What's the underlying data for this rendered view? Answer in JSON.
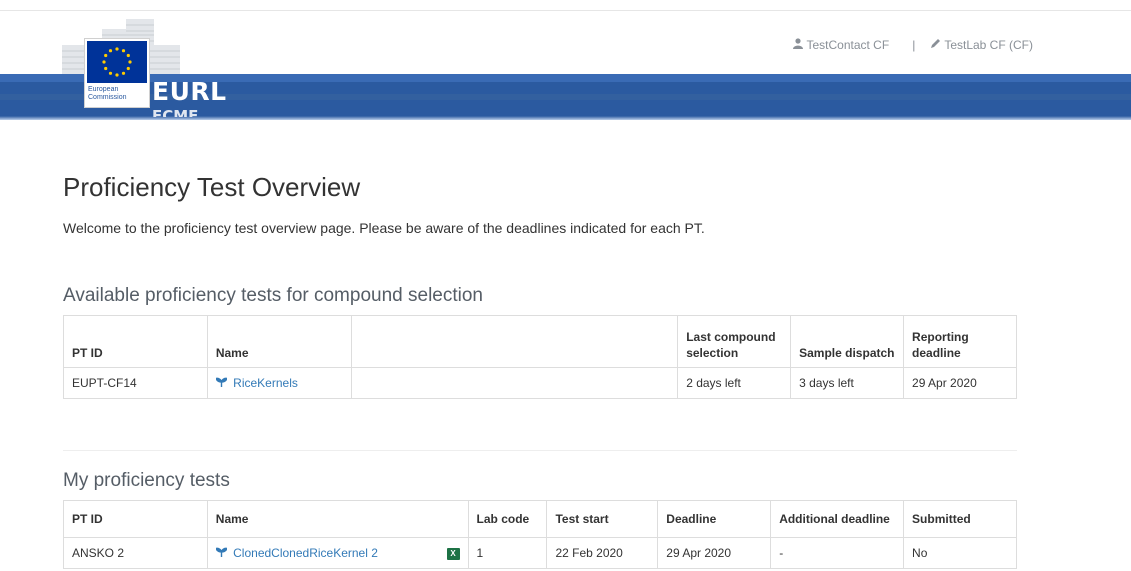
{
  "header": {
    "org_name_line1": "European",
    "org_name_line2": "Commission",
    "brand": "EURL",
    "brand_sub": "FCMF",
    "user_contact": "TestContact CF",
    "separator": "|",
    "user_lab": "TestLab CF (CF)",
    "colors": {
      "band": "#2b5aa0",
      "flag": "#003399",
      "stars": "#ffcc00"
    }
  },
  "page": {
    "title": "Proficiency Test Overview",
    "welcome": "Welcome to the proficiency test overview page. Please be aware of the deadlines indicated for each PT."
  },
  "available": {
    "heading": "Available proficiency tests for compound selection",
    "columns": {
      "pt_id": "PT ID",
      "name": "Name",
      "blank": "",
      "last_compound_selection": "Last compound selection",
      "sample_dispatch": "Sample dispatch",
      "reporting_deadline": "Reporting deadline"
    },
    "rows": [
      {
        "pt_id": "EUPT-CF14",
        "name": "RiceKernels",
        "icon": "seedling-icon",
        "blank": "",
        "last_compound_selection": "2 days left",
        "sample_dispatch": "3 days left",
        "reporting_deadline": "29 Apr 2020"
      }
    ]
  },
  "mine": {
    "heading": "My proficiency tests",
    "columns": {
      "pt_id": "PT ID",
      "name": "Name",
      "lab_code": "Lab code",
      "test_start": "Test start",
      "deadline": "Deadline",
      "additional_deadline": "Additional deadline",
      "submitted": "Submitted"
    },
    "rows": [
      {
        "pt_id": "ANSKO 2",
        "name": "ClonedClonedRiceKernel 2",
        "icon": "seedling-icon",
        "export_icon": "excel-icon",
        "lab_code": "1",
        "test_start": "22 Feb 2020",
        "deadline": "29 Apr 2020",
        "additional_deadline": "-",
        "submitted": "No"
      }
    ]
  }
}
